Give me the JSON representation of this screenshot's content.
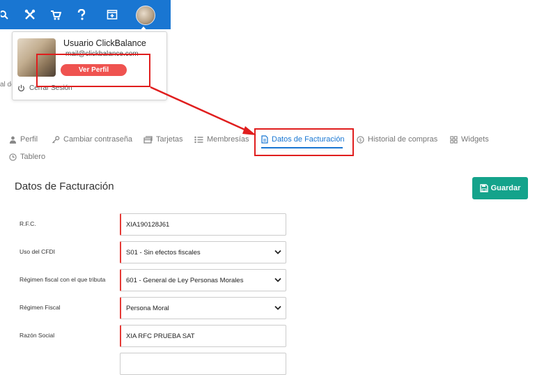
{
  "popup": {
    "user_name": "Usuario ClickBalance",
    "email": "mail@clickbalance.com",
    "view_profile": "Ver Perfil",
    "logout": "Cerrar Sesión"
  },
  "background_fragment": "al de",
  "tabs": [
    {
      "label": "Perfil",
      "icon": "person-icon"
    },
    {
      "label": "Cambiar contraseña",
      "icon": "key-icon"
    },
    {
      "label": "Tarjetas",
      "icon": "cards-icon"
    },
    {
      "label": "Membresías",
      "icon": "list-icon"
    },
    {
      "label": "Datos de Facturación",
      "icon": "document-icon",
      "active": true
    },
    {
      "label": "Historial de compras",
      "icon": "dollar-icon"
    },
    {
      "label": "Widgets",
      "icon": "grid-icon"
    },
    {
      "label": "Tablero",
      "icon": "clock-icon"
    }
  ],
  "section_title": "Datos de Facturación",
  "save_label": "Guardar",
  "fields": [
    {
      "label": "R.F.C.",
      "value": "XIA190128J61",
      "type": "text"
    },
    {
      "label": "Uso del CFDI",
      "value": "S01 - Sin efectos fiscales",
      "type": "select"
    },
    {
      "label": "Régimen fiscal con el que tributa",
      "value": "601 - General de Ley Personas Morales",
      "type": "select"
    },
    {
      "label": "Régimen Fiscal",
      "value": "Persona Moral",
      "type": "select"
    },
    {
      "label": "Razón Social",
      "value": "XIA RFC PRUEBA SAT",
      "type": "text"
    }
  ],
  "colors": {
    "topbar": "#1976d2",
    "active_tab": "#1976d2",
    "save_button": "#14a38b",
    "view_profile_button": "#ef5350",
    "annotation": "#e01e1e"
  }
}
